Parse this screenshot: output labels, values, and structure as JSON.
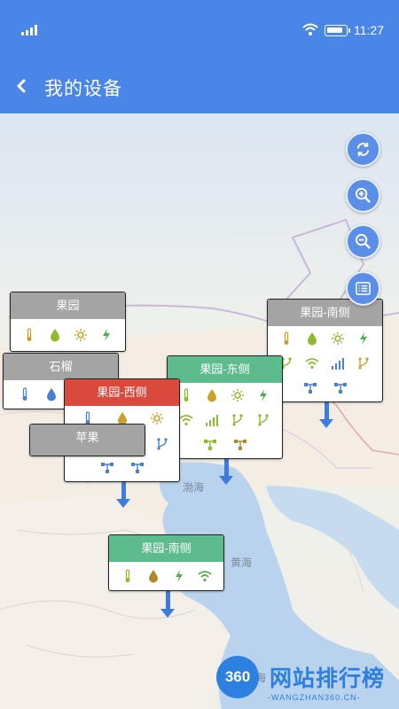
{
  "status_bar": {
    "time": "11:27"
  },
  "header": {
    "title": "我的设备"
  },
  "map": {
    "labels": {
      "bohai": "渤海",
      "huanghai": "黄海",
      "donghai": "海"
    }
  },
  "controls": [
    "refresh-icon",
    "zoom-in-icon",
    "zoom-out-icon",
    "list-icon"
  ],
  "devices": [
    {
      "name": "果园",
      "status": "gray"
    },
    {
      "name": "石榴",
      "status": "gray"
    },
    {
      "name": "果园-西侧",
      "status": "red"
    },
    {
      "name": "苹果",
      "status": "gray"
    },
    {
      "name": "果园-东侧",
      "status": "green"
    },
    {
      "name": "果园-南侧",
      "status": "gray"
    },
    {
      "name": "果园-南侧",
      "status": "green"
    }
  ],
  "colors": {
    "header": "#4a86e8",
    "offline": "#a4a4a4",
    "alarm": "#d94a3c",
    "online": "#5dbb8e",
    "pin": "#3c7be0"
  },
  "watermark": {
    "logo": "360",
    "name": "网站排行榜",
    "url": "-WANGZHAN360.CN-"
  }
}
